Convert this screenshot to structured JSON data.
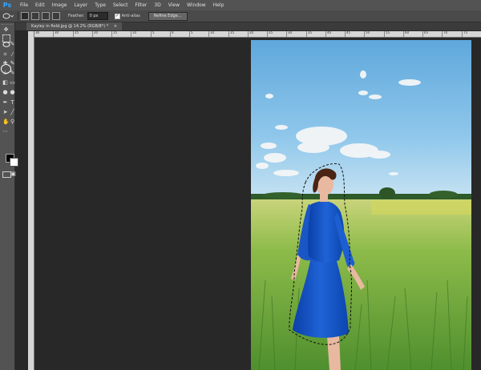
{
  "app": {
    "logo": "Ps"
  },
  "menu": [
    "File",
    "Edit",
    "Image",
    "Layer",
    "Type",
    "Select",
    "Filter",
    "3D",
    "View",
    "Window",
    "Help"
  ],
  "options": {
    "feather_label": "Feather:",
    "feather_value": "0 px",
    "antialias_label": "Anti-alias",
    "antialias_checked": true,
    "refine_edge_label": "Refine Edge..."
  },
  "document": {
    "tab_title": "Kayley in field.jpg @ 14.2% (RGB/8*) *"
  },
  "ruler": {
    "top_labels": [
      "36",
      "30",
      "25",
      "20",
      "15",
      "10",
      "5",
      "0",
      "5",
      "10",
      "15",
      "20",
      "25",
      "30",
      "35",
      "40",
      "45",
      "50",
      "55",
      "60",
      "65",
      "70",
      "75"
    ]
  },
  "tools": {
    "active": "lasso-tool",
    "foreground_color": "#000000",
    "background_color": "#ffffff"
  },
  "colors": {
    "menubar": "#535353",
    "canvas": "#282828",
    "accent": "#31a8ff"
  }
}
